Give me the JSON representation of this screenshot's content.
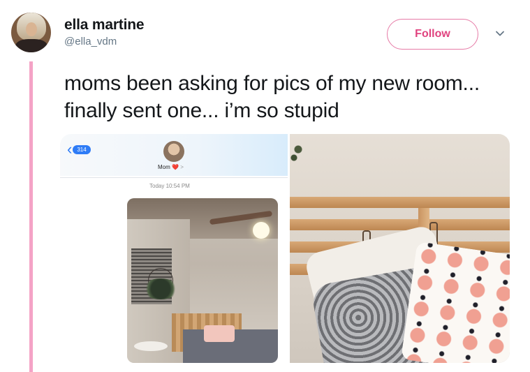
{
  "author": {
    "name": "ella martine",
    "handle": "@ella_vdm"
  },
  "actions": {
    "follow_label": "Follow"
  },
  "tweet": {
    "text": "moms been asking for pics of my new room... finally sent one... i’m so stupid"
  },
  "imessage": {
    "back_count": "314",
    "contact_name": "Mom",
    "heart": "❤️",
    "chevron": ">",
    "timestamp": "Today 10:54 PM"
  },
  "colors": {
    "accent_pink": "#e0437f",
    "thread_line": "#f4a3c6",
    "imessage_blue": "#2f7cf6"
  },
  "icons": {
    "more": "chevron-down-icon",
    "back": "chevron-left-icon"
  }
}
